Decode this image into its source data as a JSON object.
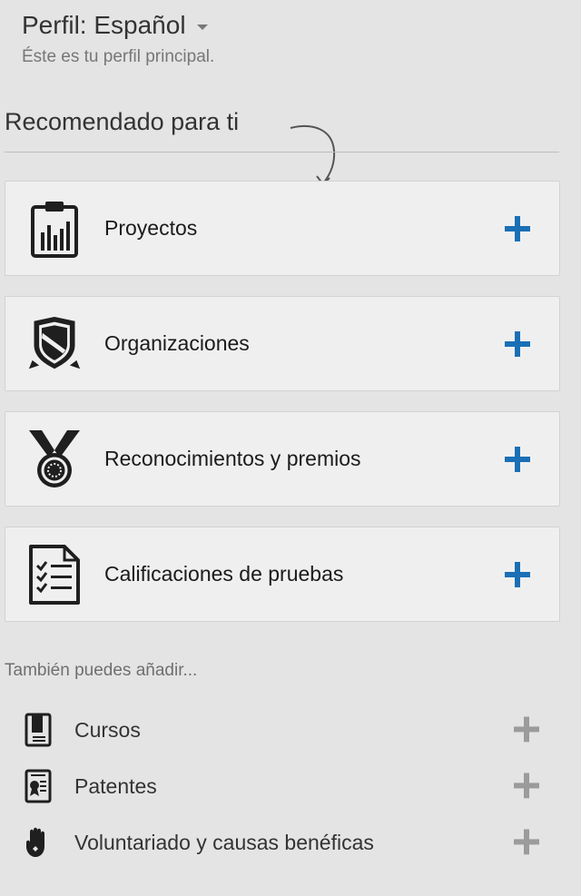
{
  "profile": {
    "title": "Perfil: Español",
    "subtitle": "Éste es tu perfil principal."
  },
  "recommended": {
    "title": "Recomendado para ti",
    "items": [
      {
        "label": "Proyectos",
        "icon": "clipboard-chart-icon"
      },
      {
        "label": "Organizaciones",
        "icon": "shield-badge-icon"
      },
      {
        "label": "Reconocimientos y premios",
        "icon": "medal-icon"
      },
      {
        "label": "Calificaciones de pruebas",
        "icon": "checklist-icon"
      }
    ]
  },
  "also": {
    "title": "También puedes añadir...",
    "items": [
      {
        "label": "Cursos",
        "icon": "book-icon"
      },
      {
        "label": "Patentes",
        "icon": "certificate-icon"
      },
      {
        "label": "Voluntariado y causas benéficas",
        "icon": "hand-icon"
      }
    ]
  },
  "colors": {
    "background": "#e4e4e4",
    "card": "#efefef",
    "accent_plus": "#1a6fb5",
    "muted_plus": "#9b9b9b"
  }
}
